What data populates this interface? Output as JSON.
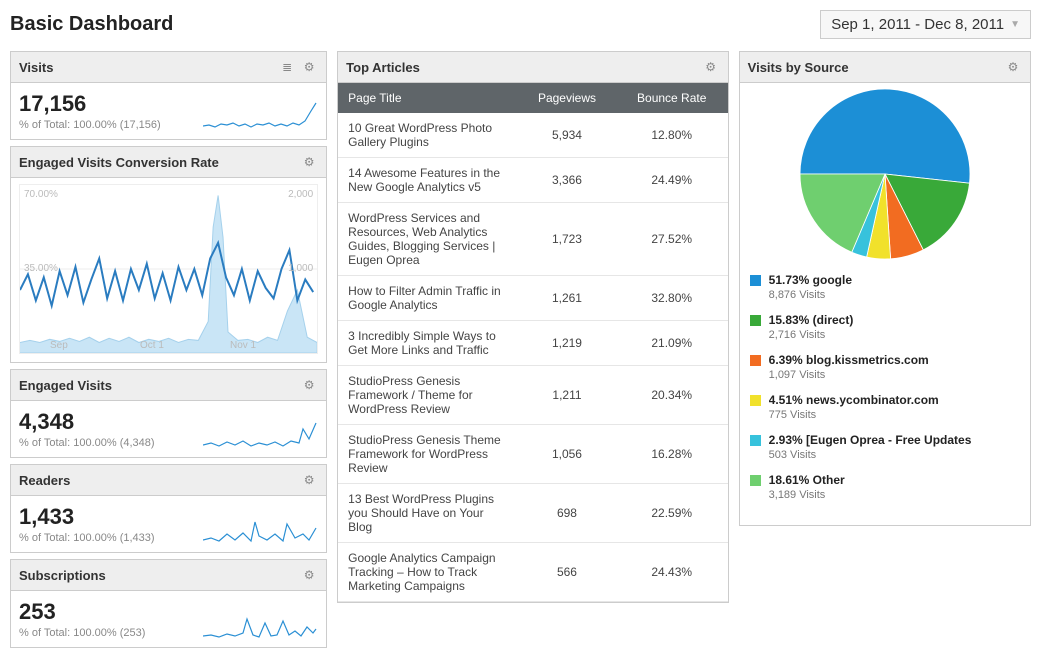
{
  "page_title": "Basic Dashboard",
  "date_range": "Sep 1, 2011 - Dec 8, 2011",
  "widgets": {
    "visits": {
      "title": "Visits",
      "value": "17,156",
      "pct": "% of Total: 100.00% (17,156)"
    },
    "conv": {
      "title": "Engaged Visits Conversion Rate",
      "y_left_top": "70.00%",
      "y_left_mid": "35.00%",
      "y_right_top": "2,000",
      "y_right_mid": "1,000",
      "x1": "Sep",
      "x2": "Oct 1",
      "x3": "Nov 1"
    },
    "engaged": {
      "title": "Engaged Visits",
      "value": "4,348",
      "pct": "% of Total: 100.00% (4,348)"
    },
    "readers": {
      "title": "Readers",
      "value": "1,433",
      "pct": "% of Total: 100.00% (1,433)"
    },
    "subs": {
      "title": "Subscriptions",
      "value": "253",
      "pct": "% of Total: 100.00% (253)"
    },
    "top_articles": {
      "title": "Top Articles",
      "col1": "Page Title",
      "col2": "Pageviews",
      "col3": "Bounce Rate",
      "rows": [
        {
          "t": "10 Great WordPress Photo Gallery Plugins",
          "pv": "5,934",
          "br": "12.80%"
        },
        {
          "t": "14 Awesome Features in the New Google Analytics v5",
          "pv": "3,366",
          "br": "24.49%"
        },
        {
          "t": "WordPress Services and Resources, Web Analytics Guides, Blogging Services | Eugen Oprea",
          "pv": "1,723",
          "br": "27.52%"
        },
        {
          "t": "How to Filter Admin Traffic in Google Analytics",
          "pv": "1,261",
          "br": "32.80%"
        },
        {
          "t": "3 Incredibly Simple Ways to Get More Links and Traffic",
          "pv": "1,219",
          "br": "21.09%"
        },
        {
          "t": "StudioPress Genesis Framework / Theme for WordPress Review",
          "pv": "1,211",
          "br": "20.34%"
        },
        {
          "t": "StudioPress Genesis Theme Framework for WordPress Review",
          "pv": "1,056",
          "br": "16.28%"
        },
        {
          "t": "13 Best WordPress Plugins you Should Have on Your Blog",
          "pv": "698",
          "br": "22.59%"
        },
        {
          "t": "Google Analytics Campaign Tracking – How to Track Marketing Campaigns",
          "pv": "566",
          "br": "24.43%"
        }
      ]
    },
    "sources": {
      "title": "Visits by Source",
      "items": [
        {
          "color": "#1c8fd6",
          "label": "51.73% google",
          "sub": "8,876 Visits",
          "value": 51.73
        },
        {
          "color": "#39a939",
          "label": "15.83% (direct)",
          "sub": "2,716 Visits",
          "value": 15.83
        },
        {
          "color": "#f26c21",
          "label": "6.39% blog.kissmetrics.com",
          "sub": "1,097 Visits",
          "value": 6.39
        },
        {
          "color": "#f1e12b",
          "label": "4.51% news.ycombinator.com",
          "sub": "775 Visits",
          "value": 4.51
        },
        {
          "color": "#37c2dc",
          "label": "2.93% [Eugen Oprea - Free Updates",
          "sub": "503 Visits",
          "value": 2.93
        },
        {
          "color": "#6fcf6f",
          "label": "18.61% Other",
          "sub": "3,189 Visits",
          "value": 18.61
        }
      ]
    }
  },
  "chart_data": [
    {
      "type": "line",
      "title": "Engaged Visits Conversion Rate",
      "note": "dual-axis daily line chart; precise values not labeled, approximate shapes only",
      "x_range": [
        "2011-09-01",
        "2011-12-08"
      ],
      "series": [
        {
          "name": "Conversion Rate",
          "axis": "left",
          "unit": "%",
          "range": [
            0,
            70
          ],
          "approx_mean": 30
        },
        {
          "name": "Visits",
          "axis": "right",
          "unit": "count",
          "range": [
            0,
            2000
          ],
          "approx_mean": 200,
          "spike_near": "2011-11-01",
          "spike_value": 2000
        }
      ]
    },
    {
      "type": "pie",
      "title": "Visits by Source",
      "categories": [
        "google",
        "(direct)",
        "blog.kissmetrics.com",
        "news.ycombinator.com",
        "[Eugen Oprea - Free Updates",
        "Other"
      ],
      "values": [
        51.73,
        15.83,
        6.39,
        4.51,
        2.93,
        18.61
      ],
      "visits": [
        8876,
        2716,
        1097,
        775,
        503,
        3189
      ]
    },
    {
      "type": "table",
      "title": "Top Articles",
      "columns": [
        "Page Title",
        "Pageviews",
        "Bounce Rate"
      ],
      "rows": [
        [
          "10 Great WordPress Photo Gallery Plugins",
          5934,
          12.8
        ],
        [
          "14 Awesome Features in the New Google Analytics v5",
          3366,
          24.49
        ],
        [
          "WordPress Services and Resources, Web Analytics Guides, Blogging Services | Eugen Oprea",
          1723,
          27.52
        ],
        [
          "How to Filter Admin Traffic in Google Analytics",
          1261,
          32.8
        ],
        [
          "3 Incredibly Simple Ways to Get More Links and Traffic",
          1219,
          21.09
        ],
        [
          "StudioPress Genesis Framework / Theme for WordPress Review",
          1211,
          20.34
        ],
        [
          "StudioPress Genesis Theme Framework for WordPress Review",
          1056,
          16.28
        ],
        [
          "13 Best WordPress Plugins you Should Have on Your Blog",
          698,
          22.59
        ],
        [
          "Google Analytics Campaign Tracking – How to Track Marketing Campaigns",
          566,
          24.43
        ]
      ]
    }
  ]
}
